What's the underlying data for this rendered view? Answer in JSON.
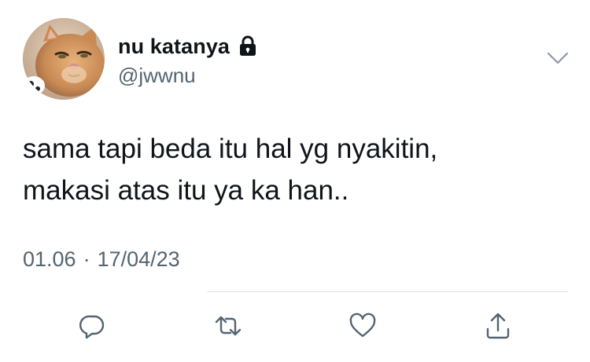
{
  "tweet": {
    "display_name": "nu katanya",
    "handle": "@jwwnu",
    "text_lines": [
      "sama tapi beda itu hal yg nyakitin,",
      "makasi atas itu ya ka han.."
    ],
    "time": "01.06",
    "separator": "·",
    "date": "17/04/23",
    "protected": true,
    "icons": {
      "lock": "lock-icon",
      "more": "chevron-down-icon",
      "reply": "reply-icon",
      "retweet": "retweet-icon",
      "like": "heart-icon",
      "share": "share-icon"
    }
  },
  "colors": {
    "text": "#0f1419",
    "secondary": "#536471",
    "divider": "#e1e6ea"
  }
}
